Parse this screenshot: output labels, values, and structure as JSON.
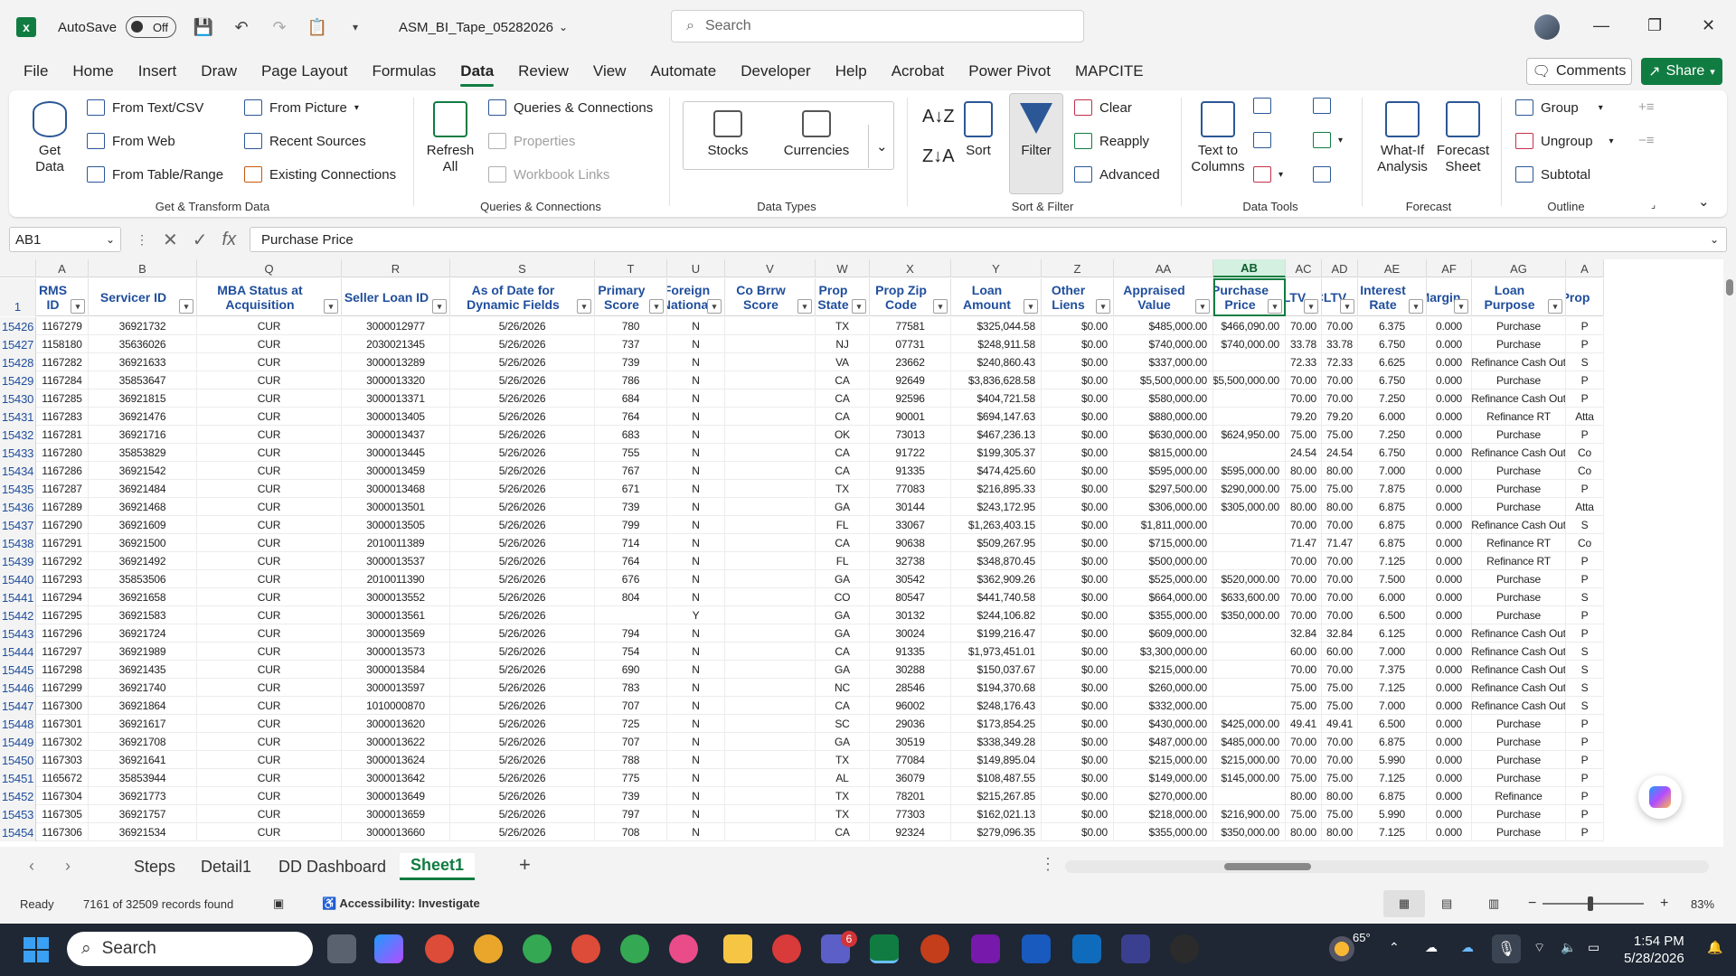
{
  "titlebar": {
    "autosave_label": "AutoSave",
    "autosave_state": "Off",
    "doc_title": "ASM_BI_Tape_05282026",
    "search_placeholder": "Search"
  },
  "menu": {
    "tabs": [
      "File",
      "Home",
      "Insert",
      "Draw",
      "Page Layout",
      "Formulas",
      "Data",
      "Review",
      "View",
      "Automate",
      "Developer",
      "Help",
      "Acrobat",
      "Power Pivot",
      "MAPCITE"
    ],
    "active": "Data",
    "comments_label": "Comments",
    "share_label": "Share"
  },
  "ribbon": {
    "get_data": "Get Data",
    "from_text_csv": "From Text/CSV",
    "from_web": "From Web",
    "from_table_range": "From Table/Range",
    "from_picture": "From Picture",
    "recent_sources": "Recent Sources",
    "existing_connections": "Existing Connections",
    "group_get_transform": "Get & Transform Data",
    "refresh_all": "Refresh All",
    "queries_connections": "Queries & Connections",
    "properties": "Properties",
    "workbook_links": "Workbook Links",
    "group_queries": "Queries & Connections",
    "stocks": "Stocks",
    "currencies": "Currencies",
    "group_data_types": "Data Types",
    "sort": "Sort",
    "filter": "Filter",
    "clear": "Clear",
    "reapply": "Reapply",
    "advanced": "Advanced",
    "group_sort_filter": "Sort & Filter",
    "text_to_columns": "Text to Columns",
    "group_data_tools": "Data Tools",
    "what_if": "What-If Analysis",
    "forecast_sheet": "Forecast Sheet",
    "group_forecast": "Forecast",
    "group_btn": "Group",
    "ungroup": "Ungroup",
    "subtotal": "Subtotal",
    "group_outline": "Outline"
  },
  "formula_bar": {
    "name_box": "AB1",
    "formula": "Purchase Price"
  },
  "grid": {
    "col_letters": [
      "A",
      "B",
      "Q",
      "R",
      "S",
      "T",
      "U",
      "V",
      "W",
      "X",
      "Y",
      "Z",
      "AA",
      "AB",
      "AC",
      "AD",
      "AE",
      "AF",
      "AG",
      "A"
    ],
    "selected_col": "AB",
    "header_row_no": "1",
    "headers": [
      "RMS ID",
      "Servicer ID",
      "MBA Status at Acquisition",
      "Seller Loan ID",
      "As of Date for Dynamic Fields",
      "Primary Score",
      "Foreign National",
      "Co Brrw Score",
      "Prop State",
      "Prop Zip Code",
      "Loan Amount",
      "Other Liens",
      "Appraised Value",
      "Purchase Price",
      "LTV",
      "CLTV",
      "Interest Rate",
      "Margin",
      "Loan Purpose",
      "Prop"
    ],
    "rows": [
      [
        "15426",
        "1167279",
        "36921732",
        "CUR",
        "3000012977",
        "5/26/2026",
        "780",
        "N",
        "",
        "TX",
        "77581",
        "$325,044.58",
        "$0.00",
        "$485,000.00",
        "$466,090.00",
        "70.00",
        "70.00",
        "6.375",
        "0.000",
        "Purchase",
        "P"
      ],
      [
        "15427",
        "1158180",
        "35636026",
        "CUR",
        "2030021345",
        "5/26/2026",
        "737",
        "N",
        "",
        "NJ",
        "07731",
        "$248,911.58",
        "$0.00",
        "$740,000.00",
        "$740,000.00",
        "33.78",
        "33.78",
        "6.750",
        "0.000",
        "Purchase",
        "P"
      ],
      [
        "15428",
        "1167282",
        "36921633",
        "CUR",
        "3000013289",
        "5/26/2026",
        "739",
        "N",
        "",
        "VA",
        "23662",
        "$240,860.43",
        "$0.00",
        "$337,000.00",
        "",
        "72.33",
        "72.33",
        "6.625",
        "0.000",
        "Refinance Cash Out",
        "S"
      ],
      [
        "15429",
        "1167284",
        "35853647",
        "CUR",
        "3000013320",
        "5/26/2026",
        "786",
        "N",
        "",
        "CA",
        "92649",
        "$3,836,628.58",
        "$0.00",
        "$5,500,000.00",
        "$5,500,000.00",
        "70.00",
        "70.00",
        "6.750",
        "0.000",
        "Purchase",
        "P"
      ],
      [
        "15430",
        "1167285",
        "36921815",
        "CUR",
        "3000013371",
        "5/26/2026",
        "684",
        "N",
        "",
        "CA",
        "92596",
        "$404,721.58",
        "$0.00",
        "$580,000.00",
        "",
        "70.00",
        "70.00",
        "7.250",
        "0.000",
        "Refinance Cash Out",
        "P"
      ],
      [
        "15431",
        "1167283",
        "36921476",
        "CUR",
        "3000013405",
        "5/26/2026",
        "764",
        "N",
        "",
        "CA",
        "90001",
        "$694,147.63",
        "$0.00",
        "$880,000.00",
        "",
        "79.20",
        "79.20",
        "6.000",
        "0.000",
        "Refinance RT",
        "Atta"
      ],
      [
        "15432",
        "1167281",
        "36921716",
        "CUR",
        "3000013437",
        "5/26/2026",
        "683",
        "N",
        "",
        "OK",
        "73013",
        "$467,236.13",
        "$0.00",
        "$630,000.00",
        "$624,950.00",
        "75.00",
        "75.00",
        "7.250",
        "0.000",
        "Purchase",
        "P"
      ],
      [
        "15433",
        "1167280",
        "35853829",
        "CUR",
        "3000013445",
        "5/26/2026",
        "755",
        "N",
        "",
        "CA",
        "91722",
        "$199,305.37",
        "$0.00",
        "$815,000.00",
        "",
        "24.54",
        "24.54",
        "6.750",
        "0.000",
        "Refinance Cash Out",
        "Co"
      ],
      [
        "15434",
        "1167286",
        "36921542",
        "CUR",
        "3000013459",
        "5/26/2026",
        "767",
        "N",
        "",
        "CA",
        "91335",
        "$474,425.60",
        "$0.00",
        "$595,000.00",
        "$595,000.00",
        "80.00",
        "80.00",
        "7.000",
        "0.000",
        "Purchase",
        "Co"
      ],
      [
        "15435",
        "1167287",
        "36921484",
        "CUR",
        "3000013468",
        "5/26/2026",
        "671",
        "N",
        "",
        "TX",
        "77083",
        "$216,895.33",
        "$0.00",
        "$297,500.00",
        "$290,000.00",
        "75.00",
        "75.00",
        "7.875",
        "0.000",
        "Purchase",
        "P"
      ],
      [
        "15436",
        "1167289",
        "36921468",
        "CUR",
        "3000013501",
        "5/26/2026",
        "739",
        "N",
        "",
        "GA",
        "30144",
        "$243,172.95",
        "$0.00",
        "$306,000.00",
        "$305,000.00",
        "80.00",
        "80.00",
        "6.875",
        "0.000",
        "Purchase",
        "Atta"
      ],
      [
        "15437",
        "1167290",
        "36921609",
        "CUR",
        "3000013505",
        "5/26/2026",
        "799",
        "N",
        "",
        "FL",
        "33067",
        "$1,263,403.15",
        "$0.00",
        "$1,811,000.00",
        "",
        "70.00",
        "70.00",
        "6.875",
        "0.000",
        "Refinance Cash Out",
        "S"
      ],
      [
        "15438",
        "1167291",
        "36921500",
        "CUR",
        "2010011389",
        "5/26/2026",
        "714",
        "N",
        "",
        "CA",
        "90638",
        "$509,267.95",
        "$0.00",
        "$715,000.00",
        "",
        "71.47",
        "71.47",
        "6.875",
        "0.000",
        "Refinance RT",
        "Co"
      ],
      [
        "15439",
        "1167292",
        "36921492",
        "CUR",
        "3000013537",
        "5/26/2026",
        "764",
        "N",
        "",
        "FL",
        "32738",
        "$348,870.45",
        "$0.00",
        "$500,000.00",
        "",
        "70.00",
        "70.00",
        "7.125",
        "0.000",
        "Refinance RT",
        "P"
      ],
      [
        "15440",
        "1167293",
        "35853506",
        "CUR",
        "2010011390",
        "5/26/2026",
        "676",
        "N",
        "",
        "GA",
        "30542",
        "$362,909.26",
        "$0.00",
        "$525,000.00",
        "$520,000.00",
        "70.00",
        "70.00",
        "7.500",
        "0.000",
        "Purchase",
        "P"
      ],
      [
        "15441",
        "1167294",
        "36921658",
        "CUR",
        "3000013552",
        "5/26/2026",
        "804",
        "N",
        "",
        "CO",
        "80547",
        "$441,740.58",
        "$0.00",
        "$664,000.00",
        "$633,600.00",
        "70.00",
        "70.00",
        "6.000",
        "0.000",
        "Purchase",
        "S"
      ],
      [
        "15442",
        "1167295",
        "36921583",
        "CUR",
        "3000013561",
        "5/26/2026",
        "",
        "Y",
        "",
        "GA",
        "30132",
        "$244,106.82",
        "$0.00",
        "$355,000.00",
        "$350,000.00",
        "70.00",
        "70.00",
        "6.500",
        "0.000",
        "Purchase",
        "P"
      ],
      [
        "15443",
        "1167296",
        "36921724",
        "CUR",
        "3000013569",
        "5/26/2026",
        "794",
        "N",
        "",
        "GA",
        "30024",
        "$199,216.47",
        "$0.00",
        "$609,000.00",
        "",
        "32.84",
        "32.84",
        "6.125",
        "0.000",
        "Refinance Cash Out",
        "P"
      ],
      [
        "15444",
        "1167297",
        "36921989",
        "CUR",
        "3000013573",
        "5/26/2026",
        "754",
        "N",
        "",
        "CA",
        "91335",
        "$1,973,451.01",
        "$0.00",
        "$3,300,000.00",
        "",
        "60.00",
        "60.00",
        "7.000",
        "0.000",
        "Refinance Cash Out",
        "S"
      ],
      [
        "15445",
        "1167298",
        "36921435",
        "CUR",
        "3000013584",
        "5/26/2026",
        "690",
        "N",
        "",
        "GA",
        "30288",
        "$150,037.67",
        "$0.00",
        "$215,000.00",
        "",
        "70.00",
        "70.00",
        "7.375",
        "0.000",
        "Refinance Cash Out",
        "S"
      ],
      [
        "15446",
        "1167299",
        "36921740",
        "CUR",
        "3000013597",
        "5/26/2026",
        "783",
        "N",
        "",
        "NC",
        "28546",
        "$194,370.68",
        "$0.00",
        "$260,000.00",
        "",
        "75.00",
        "75.00",
        "7.125",
        "0.000",
        "Refinance Cash Out",
        "S"
      ],
      [
        "15447",
        "1167300",
        "36921864",
        "CUR",
        "1010000870",
        "5/26/2026",
        "707",
        "N",
        "",
        "CA",
        "96002",
        "$248,176.43",
        "$0.00",
        "$332,000.00",
        "",
        "75.00",
        "75.00",
        "7.000",
        "0.000",
        "Refinance Cash Out",
        "S"
      ],
      [
        "15448",
        "1167301",
        "36921617",
        "CUR",
        "3000013620",
        "5/26/2026",
        "725",
        "N",
        "",
        "SC",
        "29036",
        "$173,854.25",
        "$0.00",
        "$430,000.00",
        "$425,000.00",
        "49.41",
        "49.41",
        "6.500",
        "0.000",
        "Purchase",
        "P"
      ],
      [
        "15449",
        "1167302",
        "36921708",
        "CUR",
        "3000013622",
        "5/26/2026",
        "707",
        "N",
        "",
        "GA",
        "30519",
        "$338,349.28",
        "$0.00",
        "$487,000.00",
        "$485,000.00",
        "70.00",
        "70.00",
        "6.875",
        "0.000",
        "Purchase",
        "P"
      ],
      [
        "15450",
        "1167303",
        "36921641",
        "CUR",
        "3000013624",
        "5/26/2026",
        "788",
        "N",
        "",
        "TX",
        "77084",
        "$149,895.04",
        "$0.00",
        "$215,000.00",
        "$215,000.00",
        "70.00",
        "70.00",
        "5.990",
        "0.000",
        "Purchase",
        "P"
      ],
      [
        "15451",
        "1165672",
        "35853944",
        "CUR",
        "3000013642",
        "5/26/2026",
        "775",
        "N",
        "",
        "AL",
        "36079",
        "$108,487.55",
        "$0.00",
        "$149,000.00",
        "$145,000.00",
        "75.00",
        "75.00",
        "7.125",
        "0.000",
        "Purchase",
        "P"
      ],
      [
        "15452",
        "1167304",
        "36921773",
        "CUR",
        "3000013649",
        "5/26/2026",
        "739",
        "N",
        "",
        "TX",
        "78201",
        "$215,267.85",
        "$0.00",
        "$270,000.00",
        "",
        "80.00",
        "80.00",
        "6.875",
        "0.000",
        "Refinance",
        "P"
      ],
      [
        "15453",
        "1167305",
        "36921757",
        "CUR",
        "3000013659",
        "5/26/2026",
        "797",
        "N",
        "",
        "TX",
        "77303",
        "$162,021.13",
        "$0.00",
        "$218,000.00",
        "$216,900.00",
        "75.00",
        "75.00",
        "5.990",
        "0.000",
        "Purchase",
        "P"
      ],
      [
        "15454",
        "1167306",
        "36921534",
        "CUR",
        "3000013660",
        "5/26/2026",
        "708",
        "N",
        "",
        "CA",
        "92324",
        "$279,096.35",
        "$0.00",
        "$355,000.00",
        "$350,000.00",
        "80.00",
        "80.00",
        "7.125",
        "0.000",
        "Purchase",
        "P"
      ]
    ]
  },
  "sheets": {
    "tabs": [
      "Steps",
      "Detail1",
      "DD Dashboard",
      "Sheet1"
    ],
    "active": "Sheet1"
  },
  "status": {
    "ready": "Ready",
    "records": "7161 of 32509 records found",
    "accessibility": "Accessibility: Investigate",
    "zoom": "83%"
  },
  "taskbar": {
    "search_placeholder": "Search",
    "weather": "65°",
    "time": "1:54 PM",
    "date": "5/28/2026",
    "teams_badge": "6"
  },
  "colors": {
    "excel_green": "#107c41",
    "header_blue": "#1f4e9c",
    "taskbar": "#1e2733"
  }
}
